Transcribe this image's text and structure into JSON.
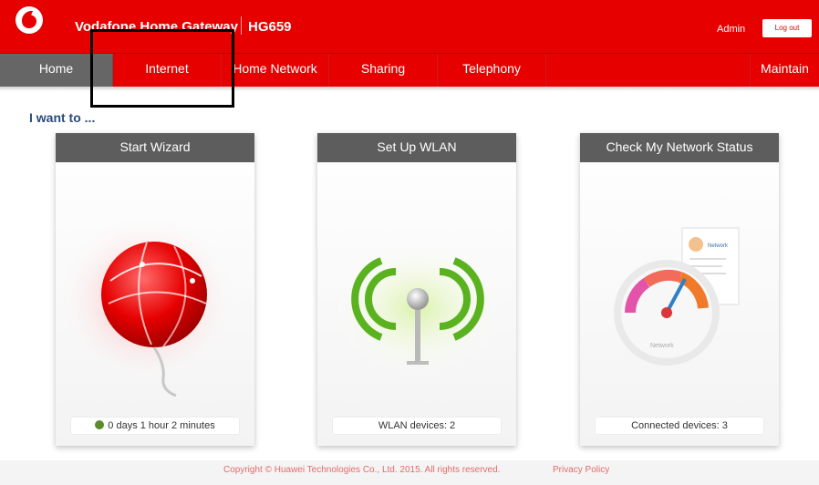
{
  "header": {
    "brand": "Vodafone Home Gateway",
    "model": "HG659",
    "user": "Admin",
    "logout_label": "Log out"
  },
  "nav": {
    "items": [
      {
        "label": "Home",
        "active": true
      },
      {
        "label": "Internet",
        "active": false
      },
      {
        "label": "Home Network",
        "active": false
      },
      {
        "label": "Sharing",
        "active": false
      },
      {
        "label": "Telephony",
        "active": false
      },
      {
        "label": "",
        "active": false
      },
      {
        "label": "Maintain",
        "active": false
      }
    ]
  },
  "main": {
    "heading": "I want to ...",
    "cards": [
      {
        "title": "Start Wizard",
        "status": "0 days 1 hour 2 minutes",
        "icon": "globe-balloon-icon"
      },
      {
        "title": "Set Up WLAN",
        "status": "WLAN devices: 2",
        "icon": "wifi-antenna-icon"
      },
      {
        "title": "Check My Network Status",
        "status": "Connected devices: 3",
        "icon": "network-gauge-icon",
        "gauge_label": "Network",
        "doc_label": "Network"
      }
    ]
  },
  "footer": {
    "copyright": "Copyright © Huawei Technologies Co., Ltd. 2015. All rights reserved.",
    "privacy_label": "Privacy Policy"
  },
  "colors": {
    "brand_red": "#e60000",
    "nav_active": "#666666",
    "card_header": "#5d5d5d",
    "status_dot": "#5b8c2a"
  }
}
